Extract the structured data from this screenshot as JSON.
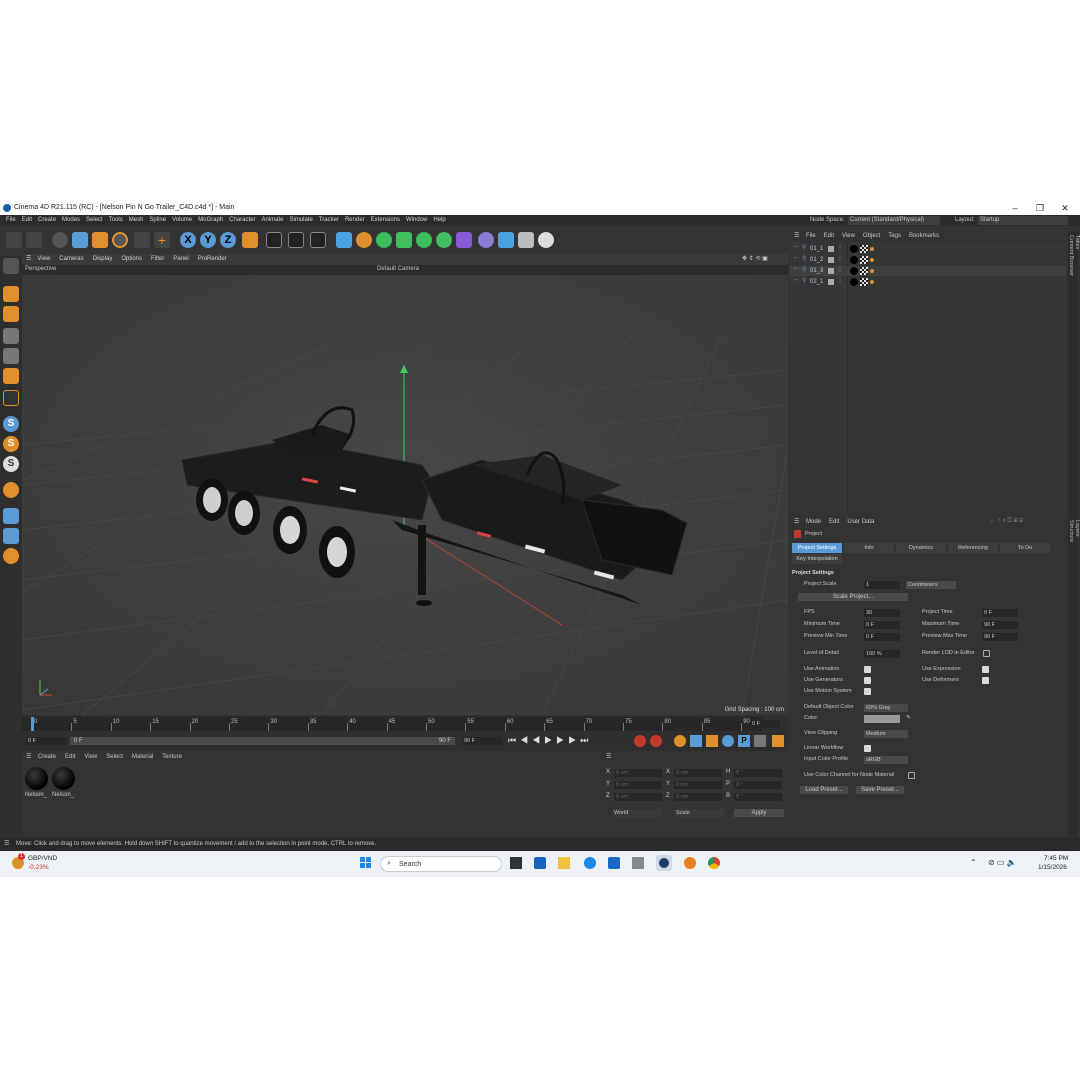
{
  "window": {
    "title": "Cinema 4D R21.115 (RC) - [Nelson Pin N Go Trailer_C4D.c4d *] - Main"
  },
  "menu": {
    "items": [
      "File",
      "Edit",
      "Create",
      "Modes",
      "Select",
      "Tools",
      "Mesh",
      "Spline",
      "Volume",
      "MoGraph",
      "Character",
      "Animate",
      "Simulate",
      "Tracker",
      "Render",
      "Extensions",
      "Window",
      "Help"
    ],
    "node_space_label": "Node Space:",
    "node_space_value": "Current (Standard/Physical)",
    "layout_label": "Layout:",
    "layout_value": "Startup"
  },
  "viewport": {
    "menu": [
      "View",
      "Cameras",
      "Display",
      "Options",
      "Filter",
      "Panel",
      "ProRender"
    ],
    "name": "Perspective",
    "camera": "Default Camera",
    "grid_spacing": "Grid Spacing : 100 cm"
  },
  "timeline": {
    "ticks": [
      "0",
      "5",
      "10",
      "15",
      "20",
      "25",
      "30",
      "35",
      "40",
      "45",
      "50",
      "55",
      "60",
      "65",
      "70",
      "75",
      "80",
      "85",
      "90"
    ],
    "current_frame": "0 F",
    "start": "0 F",
    "range_start": "0 F",
    "range_end": "90 F",
    "end": "90 F"
  },
  "materials": {
    "menu": [
      "Create",
      "Edit",
      "View",
      "Select",
      "Material",
      "Texture"
    ],
    "items": [
      {
        "name": "Nelson_"
      },
      {
        "name": "Nelson_"
      }
    ]
  },
  "coords": {
    "rows": [
      {
        "a": "X",
        "av": "0 cm",
        "b": "X",
        "bv": "0 cm",
        "c": "H",
        "cv": "0 °"
      },
      {
        "a": "Y",
        "av": "0 cm",
        "b": "Y",
        "bv": "0 cm",
        "c": "P",
        "cv": "0 °"
      },
      {
        "a": "Z",
        "av": "0 cm",
        "b": "Z",
        "bv": "0 cm",
        "c": "B",
        "cv": "0 °"
      }
    ],
    "mode1": "World",
    "mode2": "Scale",
    "apply": "Apply"
  },
  "objects": {
    "menu": [
      "File",
      "Edit",
      "View",
      "Object",
      "Tags",
      "Bookmarks"
    ],
    "items": [
      "01_1",
      "01_2",
      "01_3",
      "02_1"
    ]
  },
  "attributes": {
    "menu": [
      "Mode",
      "Edit",
      "User Data"
    ],
    "title": "Project",
    "tabs": [
      "Project Settings",
      "Info",
      "Dynamics",
      "Referencing",
      "To Do"
    ],
    "tab2": "Key Interpolation",
    "section": "Project Settings",
    "project_scale_label": "Project Scale",
    "project_scale": "1",
    "project_scale_unit": "Centimeters",
    "scale_button": "Scale Project...",
    "fps_label": "FPS",
    "fps": "30",
    "project_time_label": "Project Time",
    "project_time": "0 F",
    "min_time_label": "Minimum Time",
    "min_time": "0 F",
    "max_time_label": "Maximum Time",
    "max_time": "90 F",
    "prev_min_label": "Preview Min Time",
    "prev_min": "0 F",
    "prev_max_label": "Preview Max Time",
    "prev_max": "90 F",
    "lod_label": "Level of Detail",
    "lod": "100 %",
    "render_lod_label": "Render LOD in Editor",
    "use_animation": "Use Animation",
    "use_expression": "Use Expression",
    "use_generators": "Use Generators",
    "use_deformers": "Use Deformers",
    "use_motion": "Use Motion System",
    "default_color_label": "Default Object Color",
    "default_color": "60% Gray",
    "color_label": "Color",
    "view_clipping_label": "View Clipping",
    "view_clipping": "Medium",
    "linear_workflow": "Linear Workflow",
    "input_profile_label": "Input Color Profile",
    "input_profile": "sRGB",
    "node_material": "Use Color Channel for Node Material",
    "load_preset": "Load Preset...",
    "save_preset": "Save Preset..."
  },
  "right_tabs": [
    "Objects",
    "Takes",
    "Content Browser"
  ],
  "right_tabs2": [
    "Attributes",
    "Layers",
    "Structure"
  ],
  "status": "Move: Click and drag to move elements. Hold down SHIFT to quantize movement / add to the selection in point mode, CTRL to remove.",
  "taskbar": {
    "ticker": "GBP/VND",
    "change": "-0,23%",
    "badge": "1",
    "search": "Search",
    "time": "7:45 PM",
    "date": "1/15/2026"
  },
  "colors": {
    "accent": "#5b9bd5",
    "panel": "#333333",
    "viewport": "#3d3d3d"
  }
}
